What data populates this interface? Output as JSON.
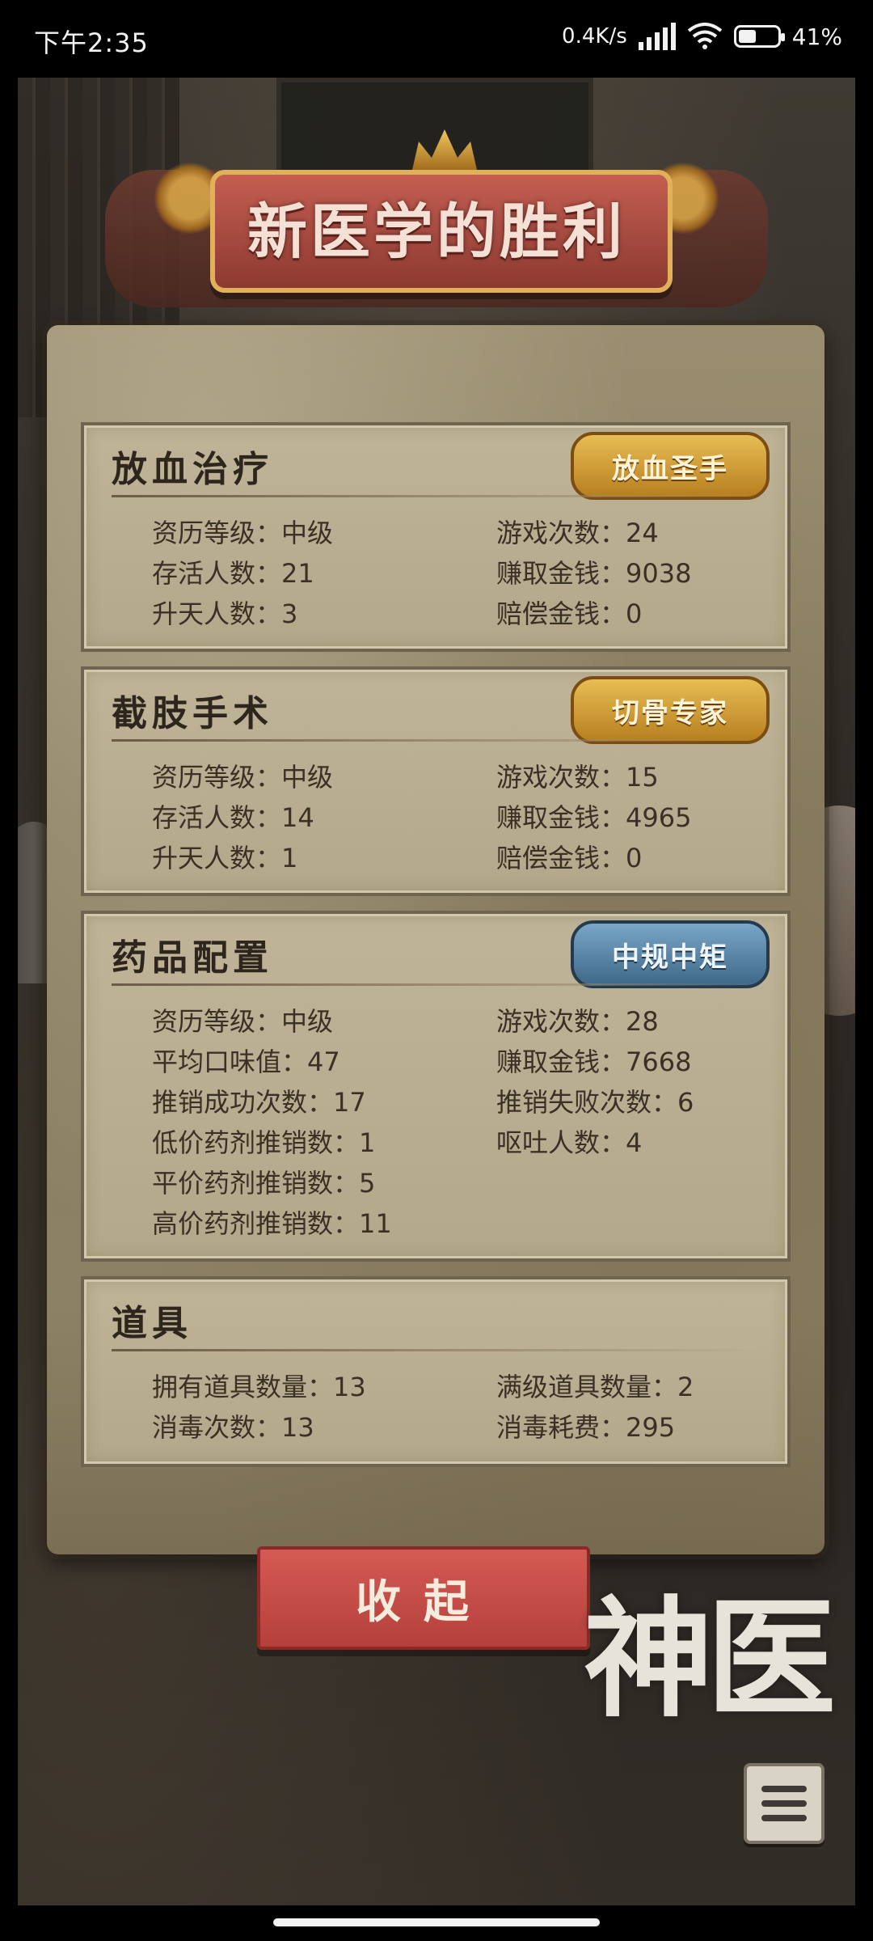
{
  "status_bar": {
    "time": "下午2:35",
    "net_speed": "0.4K/s",
    "battery_text": "41%",
    "battery_level": 0.41
  },
  "banner": {
    "title": "新医学的胜利"
  },
  "sections": {
    "bloodletting": {
      "title": "放血治疗",
      "badge": "放血圣手",
      "stats": [
        "资历等级：中级",
        "游戏次数：24",
        "存活人数：21",
        "赚取金钱：9038",
        "升天人数：3",
        "赔偿金钱：0"
      ]
    },
    "amputation": {
      "title": "截肢手术",
      "badge": "切骨专家",
      "stats": [
        "资历等级：中级",
        "游戏次数：15",
        "存活人数：14",
        "赚取金钱：4965",
        "升天人数：1",
        "赔偿金钱：0"
      ]
    },
    "medicine": {
      "title": "药品配置",
      "badge": "中规中矩",
      "stats": [
        "资历等级：中级",
        "游戏次数：28",
        "平均口味值：47",
        "赚取金钱：7668",
        "推销成功次数：17",
        "推销失败次数：6",
        "低价药剂推销数：1",
        "呕吐人数：4",
        "平价药剂推销数：5",
        "",
        "高价药剂推销数：11",
        ""
      ]
    },
    "items": {
      "title": "道具",
      "stats": [
        "拥有道具数量：13",
        "满级道具数量：2",
        "消毒次数：13",
        "消毒耗费：295"
      ]
    }
  },
  "collapse_button": {
    "label": "收起"
  },
  "logo": {
    "text": "神医"
  },
  "icons": {
    "menu": "list-icon"
  }
}
